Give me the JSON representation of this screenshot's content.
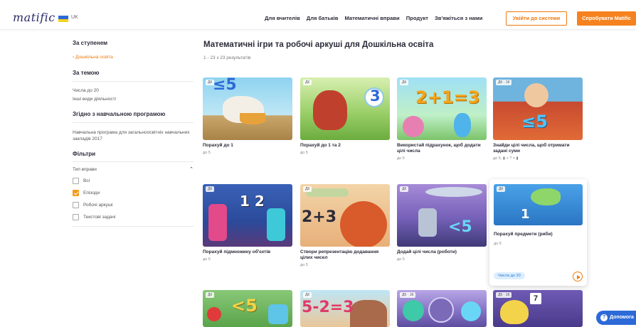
{
  "header": {
    "logo": "matific",
    "lang": "UK",
    "nav": [
      "Для вчителів",
      "Для батьків",
      "Математичні вправи",
      "Продукт",
      "Зв'яжіться з нами"
    ],
    "login": "Увійти до системи",
    "try": "Спробувати Matific"
  },
  "sidebar": {
    "by_level": "За ступенем",
    "level_link": "‹ Дошкільна освіта",
    "by_topic": "За темою",
    "topics": [
      "Числа до 20",
      "Інші види діяльності"
    ],
    "by_program": "Згідно з навчальною програмою",
    "program": "Навчальна програма для загальноосвітніх навчальних закладів 2017",
    "filters": "Фільтри",
    "type_label": "Тип вправи",
    "options": [
      "Всі",
      "Епізоди",
      "Робочі аркуші",
      "Текстові задачі"
    ]
  },
  "main": {
    "title": "Математичні ігри та робочі аркуші для Дошкільна освіта",
    "count": "1 - 23 з 23 результатів"
  },
  "cards": [
    {
      "tag": "ДК",
      "title": "Порахуй до 1",
      "age": "до 5",
      "art": "≤5"
    },
    {
      "tag": "ДК",
      "title": "Порахуй до 1 та 2",
      "age": "до 5",
      "art": "3"
    },
    {
      "tag": "ДК",
      "title": "Використай підрахунок, щоб додати цілі числа",
      "age": "до 5",
      "art": "2+1=3"
    },
    {
      "tag": "ДК · 1К",
      "title": "Знайди цілі числа, щоб отримати задані суми",
      "age": "до 5,",
      "extra": "▮ + ? = ▮",
      "art": "≤5"
    },
    {
      "tag": "ДК",
      "title": "Порахуй підмножину об'єктів",
      "age": "до 5",
      "art": "1 2"
    },
    {
      "tag": "ДК",
      "title": "Створи репрезентацію додавання цілих чисел",
      "age": "до 5",
      "art": "2+3"
    },
    {
      "tag": "ДК",
      "title": "Додай цілі числа (роботи)",
      "age": "до 5",
      "art": "<5"
    },
    {
      "tag": "ДК",
      "title": "Порахуй предмети (риби)",
      "age": "до 5",
      "art": "1",
      "badge": "Числа до 20"
    },
    {
      "tag": "ДК",
      "art": "<5"
    },
    {
      "tag": "ДК",
      "art": "5-2=3"
    },
    {
      "tag": "ДК · 1К",
      "art": ""
    },
    {
      "tag": "ДК · 1К",
      "art": "7"
    }
  ],
  "help": "Допомога",
  "help_icon": "?",
  "colors": {
    "accent": "#f5821f",
    "brand": "#2b2b6a",
    "help": "#2d6ad8"
  }
}
